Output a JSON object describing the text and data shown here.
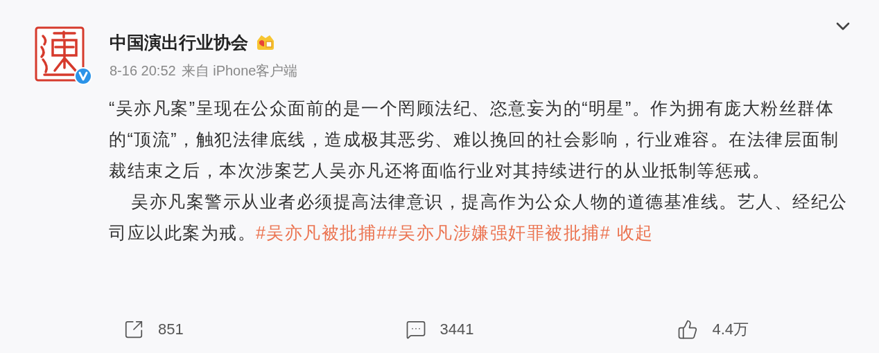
{
  "post": {
    "author": "中国演出行业协会",
    "time": "8-16 20:52",
    "source": "来自 iPhone客户端",
    "paragraphs": [
      {
        "text": "“吴亦凡案”呈现在公众面前的是一个罔顾法纪、恣意妄为的“明星”。作为拥有庞大粉丝群体的“顶流”，触犯法律底线，造成极其恶劣、难以挽回的社会影响，行业难容。在法律层面制裁结束之后，本次涉案艺人吴亦凡还将面临行业对其持续进行的从业抵制等惩戒。"
      },
      {
        "text": "吴亦凡案警示从业者必须提高法律意识，提高作为公众人物的道德基准线。艺人、经纪公司应以此案为戒。",
        "hashtags": [
          "#吴亦凡被批捕#",
          "#吴亦凡涉嫌强奸罪被批捕#"
        ],
        "collapse": "收起"
      }
    ],
    "actions": [
      {
        "kind": "repost",
        "count": "851"
      },
      {
        "kind": "comment",
        "count": "3441"
      },
      {
        "kind": "like",
        "count": "4.4万"
      }
    ]
  }
}
